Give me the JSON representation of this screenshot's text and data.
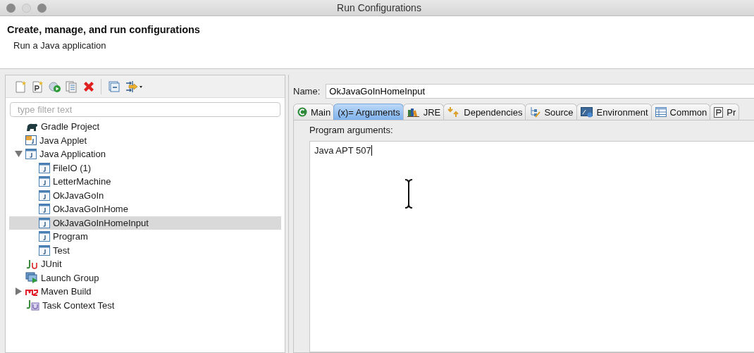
{
  "window": {
    "title": "Run Configurations"
  },
  "header": {
    "title": "Create, manage, and run configurations",
    "subtitle": "Run a Java application"
  },
  "filter": {
    "placeholder": "type filter text"
  },
  "launch_types": [
    {
      "label": "Gradle Project",
      "kind": "gradle",
      "selected": false
    },
    {
      "label": "Java Applet",
      "kind": "applet",
      "selected": false
    },
    {
      "label": "Java Application",
      "kind": "java",
      "selected": false,
      "expanded": true,
      "children": [
        {
          "label": "FileIO (1)",
          "kind": "java",
          "selected": false
        },
        {
          "label": "LetterMachine",
          "kind": "java",
          "selected": false
        },
        {
          "label": "OkJavaGoIn",
          "kind": "java",
          "selected": false
        },
        {
          "label": "OkJavaGoInHome",
          "kind": "java",
          "selected": false
        },
        {
          "label": "OkJavaGoInHomeInput",
          "kind": "java",
          "selected": true
        },
        {
          "label": "Program",
          "kind": "java",
          "selected": false
        },
        {
          "label": "Test",
          "kind": "java",
          "selected": false
        }
      ]
    },
    {
      "label": "JUnit",
      "kind": "junit",
      "selected": false
    },
    {
      "label": "Launch Group",
      "kind": "launch",
      "selected": false
    },
    {
      "label": "Maven Build",
      "kind": "maven",
      "selected": false,
      "expanded": false
    },
    {
      "label": "Task Context Test",
      "kind": "task",
      "selected": false
    }
  ],
  "name_field": {
    "label": "Name:",
    "value": "OkJavaGoInHomeInput"
  },
  "tabs": [
    {
      "label": "Main",
      "kind": "main",
      "selected": false
    },
    {
      "label": "(x)= Arguments",
      "kind": "args",
      "selected": true
    },
    {
      "label": "JRE",
      "kind": "jre",
      "selected": false
    },
    {
      "label": "Dependencies",
      "kind": "deps",
      "selected": false
    },
    {
      "label": "Source",
      "kind": "source",
      "selected": false
    },
    {
      "label": "Environment",
      "kind": "env",
      "selected": false
    },
    {
      "label": "Common",
      "kind": "common",
      "selected": false
    },
    {
      "label": "Pr",
      "kind": "proto",
      "selected": false
    }
  ],
  "program_arguments": {
    "label": "Program arguments:",
    "value": "Java APT 507"
  }
}
